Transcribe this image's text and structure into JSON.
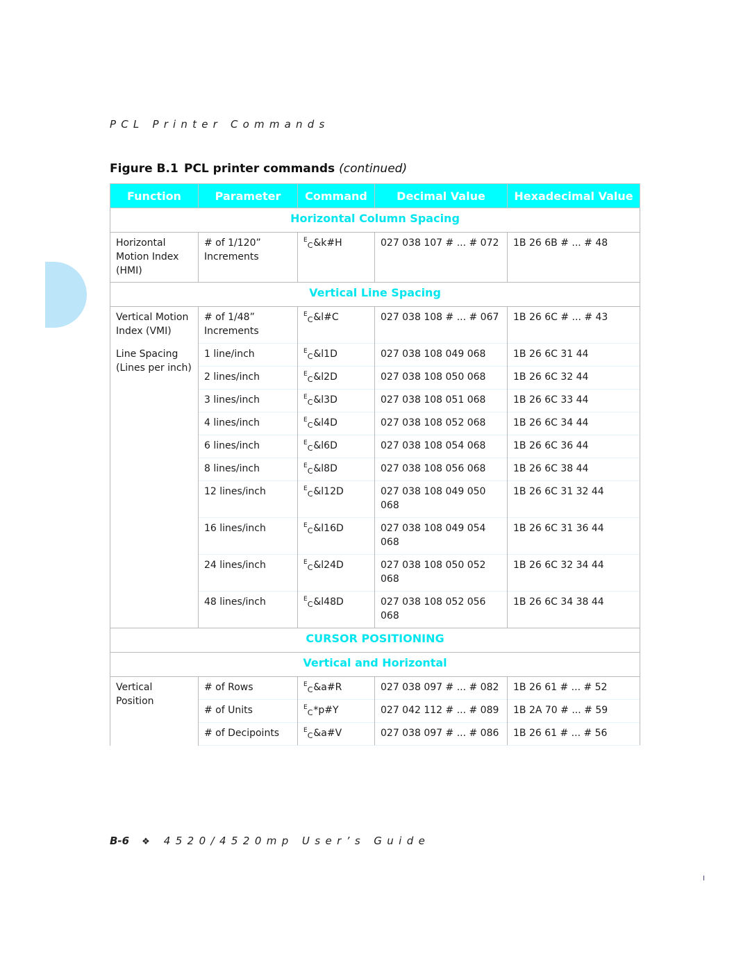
{
  "running_head": "PCL Printer Commands",
  "figure": {
    "number": "Figure B.1",
    "title": "PCL printer commands",
    "continued": "(continued)"
  },
  "table": {
    "headers": [
      "Function",
      "Parameter",
      "Command",
      "Decimal Value",
      "Hexadecimal Value"
    ],
    "sections": {
      "hcs": "Horizontal Column Spacing",
      "vls": "Vertical Line Spacing",
      "cursor": "CURSOR POSITIONING",
      "vh": "Vertical and Horizontal"
    },
    "hmi": {
      "function": "Horizontal Motion Index (HMI)",
      "parameter": "# of 1/120” Increments",
      "command": "&k#H",
      "decimal": "027 038 107 # ... # 072",
      "hex": "1B 26 6B # ... # 48"
    },
    "vmi": {
      "function": "Vertical Motion Index (VMI)",
      "parameter": "# of 1/48” Increments",
      "command": "&l#C",
      "decimal": "027 038 108 # ... # 067",
      "hex": "1B 26 6C # ... # 43"
    },
    "line_spacing": {
      "function": "Line Spacing (Lines per inch)",
      "rows": [
        {
          "parameter": "1 line/inch",
          "command": "&l1D",
          "decimal": "027 038 108 049 068",
          "hex": "1B 26 6C 31 44"
        },
        {
          "parameter": "2 lines/inch",
          "command": "&l2D",
          "decimal": "027 038 108 050 068",
          "hex": "1B 26 6C 32 44"
        },
        {
          "parameter": "3 lines/inch",
          "command": "&l3D",
          "decimal": "027 038 108 051 068",
          "hex": "1B 26 6C 33 44"
        },
        {
          "parameter": "4 lines/inch",
          "command": "&l4D",
          "decimal": "027 038 108 052 068",
          "hex": "1B 26 6C 34 44"
        },
        {
          "parameter": "6 lines/inch",
          "command": "&l6D",
          "decimal": "027 038 108 054 068",
          "hex": "1B 26 6C 36 44"
        },
        {
          "parameter": "8 lines/inch",
          "command": "&l8D",
          "decimal": "027 038 108 056 068",
          "hex": "1B 26 6C 38 44"
        },
        {
          "parameter": "12 lines/inch",
          "command": "&l12D",
          "decimal": "027 038 108 049 050 068",
          "hex": "1B 26 6C 31 32 44"
        },
        {
          "parameter": "16 lines/inch",
          "command": "&l16D",
          "decimal": "027 038 108 049 054 068",
          "hex": "1B 26 6C 31 36 44"
        },
        {
          "parameter": "24 lines/inch",
          "command": "&l24D",
          "decimal": "027 038 108 050 052 068",
          "hex": "1B 26 6C 32 34 44"
        },
        {
          "parameter": "48 lines/inch",
          "command": "&l48D",
          "decimal": "027 038 108 052 056 068",
          "hex": "1B 26 6C 34 38 44"
        }
      ]
    },
    "vertical_position": {
      "function": "Vertical Position",
      "rows": [
        {
          "parameter": "# of Rows",
          "command": "&a#R",
          "decimal": "027 038 097 # ... # 082",
          "hex": "1B 26 61 # ... # 52"
        },
        {
          "parameter": "# of Units",
          "command": "*p#Y",
          "decimal": "027 042 112 # ... # 089",
          "hex": "1B 2A 70 # ... # 59"
        },
        {
          "parameter": "# of Decipoints",
          "command": "&a#V",
          "decimal": "027 038 097 # ... # 086",
          "hex": "1B 26 61 # ... # 56"
        }
      ]
    },
    "esc_prefix": {
      "e": "E",
      "c": "C"
    }
  },
  "footer": {
    "page": "B-6",
    "ornament": "❖",
    "title": "4520/4520mp User’s Guide"
  },
  "colors": {
    "header_bg": "#00ffff",
    "section_text": "#00e5ee",
    "side_tab": "#bde5fa"
  }
}
